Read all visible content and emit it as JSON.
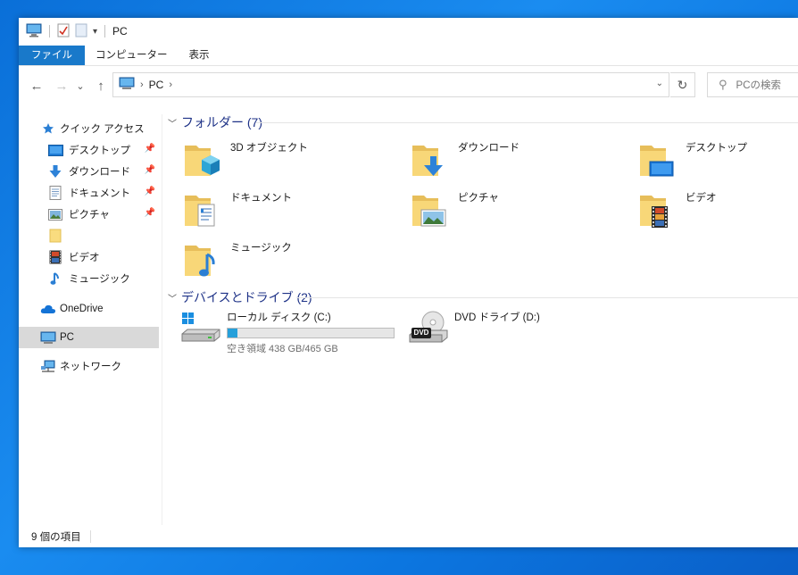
{
  "window": {
    "title": "PC",
    "quick_access_toolbar": [
      "computer-icon",
      "properties-icon",
      "new-folder-icon",
      "customize-dropdown-icon"
    ]
  },
  "ribbon": {
    "tabs": [
      {
        "label": "ファイル",
        "active": true
      },
      {
        "label": "コンピューター"
      },
      {
        "label": "表示"
      }
    ]
  },
  "navbar": {
    "back": "←",
    "forward": "→",
    "recent": "⌄",
    "up": "↑",
    "address": {
      "root_sep": "›",
      "location": "PC",
      "trail_sep": "›"
    },
    "dropdown": "⌄",
    "refresh": "↻",
    "search_placeholder": "PCの検索"
  },
  "sidebar": {
    "quick_access": {
      "label": "クイック アクセス"
    },
    "pinned": [
      {
        "label": "デスクトップ",
        "icon": "desktop-icon",
        "pinned": true
      },
      {
        "label": "ダウンロード",
        "icon": "download-icon",
        "pinned": true
      },
      {
        "label": "ドキュメント",
        "icon": "documents-icon",
        "pinned": true
      },
      {
        "label": "ピクチャ",
        "icon": "pictures-icon",
        "pinned": true
      },
      {
        "label": "",
        "icon": "folder-icon"
      },
      {
        "label": "ビデオ",
        "icon": "videos-icon"
      },
      {
        "label": "ミュージック",
        "icon": "music-icon"
      }
    ],
    "onedrive": {
      "label": "OneDrive"
    },
    "pc": {
      "label": "PC",
      "selected": true
    },
    "network": {
      "label": "ネットワーク"
    }
  },
  "content": {
    "folders_header": {
      "label": "フォルダー (7)"
    },
    "folders": [
      {
        "label": "3D オブジェクト",
        "icon": "3d-objects-icon"
      },
      {
        "label": "ダウンロード",
        "icon": "downloads-folder-icon"
      },
      {
        "label": "デスクトップ",
        "icon": "desktop-folder-icon"
      },
      {
        "label": "ドキュメント",
        "icon": "documents-folder-icon"
      },
      {
        "label": "ピクチャ",
        "icon": "pictures-folder-icon"
      },
      {
        "label": "ビデオ",
        "icon": "videos-folder-icon"
      },
      {
        "label": "ミュージック",
        "icon": "music-folder-icon"
      }
    ],
    "devices_header": {
      "label": "デバイスとドライブ (2)"
    },
    "drives": [
      {
        "label": "ローカル ディスク (C:)",
        "space": "空き領域 438 GB/465 GB",
        "used_fraction": 0.058,
        "icon": "hard-drive-icon"
      },
      {
        "label": "DVD ドライブ (D:)",
        "icon": "dvd-drive-icon",
        "badge": "DVD"
      }
    ]
  },
  "status": {
    "item_count": "9 個の項目"
  },
  "colors": {
    "accent": "#1979ca",
    "header_blue": "#1e3287",
    "bar_fill": "#26a0da",
    "folder": "#f7d674"
  }
}
